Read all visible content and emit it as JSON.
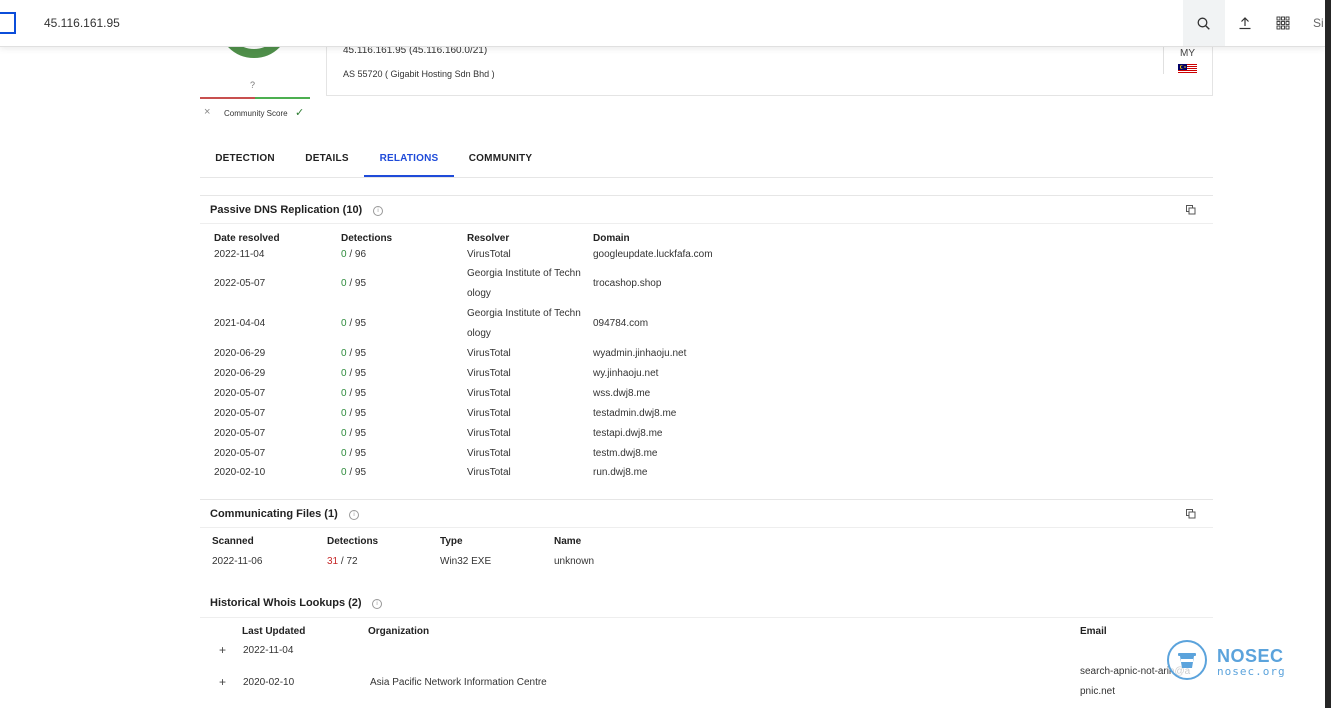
{
  "search": {
    "query": "45.116.161.95"
  },
  "topbar": {
    "signin_fragment": "Si"
  },
  "community": {
    "unknown_mark": "?",
    "label": "Community Score",
    "downvote": "×",
    "upvote": "✓"
  },
  "ip_info": {
    "ip_line": "45.116.161.95  (45.116.160.0/21)",
    "as_line": "AS 55720 ( Gigabit Hosting Sdn Bhd )",
    "country_code": "MY"
  },
  "tabs": [
    {
      "label": "DETECTION",
      "active": false
    },
    {
      "label": "DETAILS",
      "active": false
    },
    {
      "label": "RELATIONS",
      "active": true
    },
    {
      "label": "COMMUNITY",
      "active": false
    }
  ],
  "passive_dns": {
    "title": "Passive DNS Replication (10)",
    "columns": [
      "Date resolved",
      "Detections",
      "Resolver",
      "Domain"
    ],
    "rows": [
      {
        "date": "2022-11-04",
        "det": "0",
        "total": " / 96",
        "resolver": "VirusTotal",
        "resolver2": "",
        "domain": "googleupdate.luckfafa.com"
      },
      {
        "date": "2022-05-07",
        "det": "0",
        "total": " / 95",
        "resolver": "Georgia Institute of Techn",
        "resolver2": "ology",
        "domain": "trocashop.shop"
      },
      {
        "date": "2021-04-04",
        "det": "0",
        "total": " / 95",
        "resolver": "Georgia Institute of Techn",
        "resolver2": "ology",
        "domain": "094784.com"
      },
      {
        "date": "2020-06-29",
        "det": "0",
        "total": " / 95",
        "resolver": "VirusTotal",
        "resolver2": "",
        "domain": "wyadmin.jinhaoju.net"
      },
      {
        "date": "2020-06-29",
        "det": "0",
        "total": " / 95",
        "resolver": "VirusTotal",
        "resolver2": "",
        "domain": "wy.jinhaoju.net"
      },
      {
        "date": "2020-05-07",
        "det": "0",
        "total": " / 95",
        "resolver": "VirusTotal",
        "resolver2": "",
        "domain": "wss.dwj8.me"
      },
      {
        "date": "2020-05-07",
        "det": "0",
        "total": " / 95",
        "resolver": "VirusTotal",
        "resolver2": "",
        "domain": "testadmin.dwj8.me"
      },
      {
        "date": "2020-05-07",
        "det": "0",
        "total": " / 95",
        "resolver": "VirusTotal",
        "resolver2": "",
        "domain": "testapi.dwj8.me"
      },
      {
        "date": "2020-05-07",
        "det": "0",
        "total": " / 95",
        "resolver": "VirusTotal",
        "resolver2": "",
        "domain": "testm.dwj8.me"
      },
      {
        "date": "2020-02-10",
        "det": "0",
        "total": " / 95",
        "resolver": "VirusTotal",
        "resolver2": "",
        "domain": "run.dwj8.me"
      }
    ]
  },
  "comm_files": {
    "title": "Communicating Files (1)",
    "columns": [
      "Scanned",
      "Detections",
      "Type",
      "Name"
    ],
    "rows": [
      {
        "scanned": "2022-11-06",
        "det": "31",
        "total": " / 72",
        "type": "Win32 EXE",
        "name": "unknown"
      }
    ]
  },
  "whois": {
    "title": "Historical Whois Lookups (2)",
    "columns": [
      "Last Updated",
      "Organization",
      "Email"
    ],
    "rows": [
      {
        "expand": "+",
        "date": "2022-11-04",
        "org": "",
        "email1": "",
        "email2": ""
      },
      {
        "expand": "+",
        "date": "2020-02-10",
        "org": "Asia Pacific Network Information Centre",
        "email1": "search-apnic-not-arin@a",
        "email2": "pnic.net"
      }
    ]
  },
  "watermark": {
    "name": "NOSEC",
    "url": "nosec.org"
  },
  "colors": {
    "accent": "#1f4bd9",
    "clean": "#2e8b3c",
    "malicious": "#c62828",
    "watermark": "#5ba3dc"
  }
}
